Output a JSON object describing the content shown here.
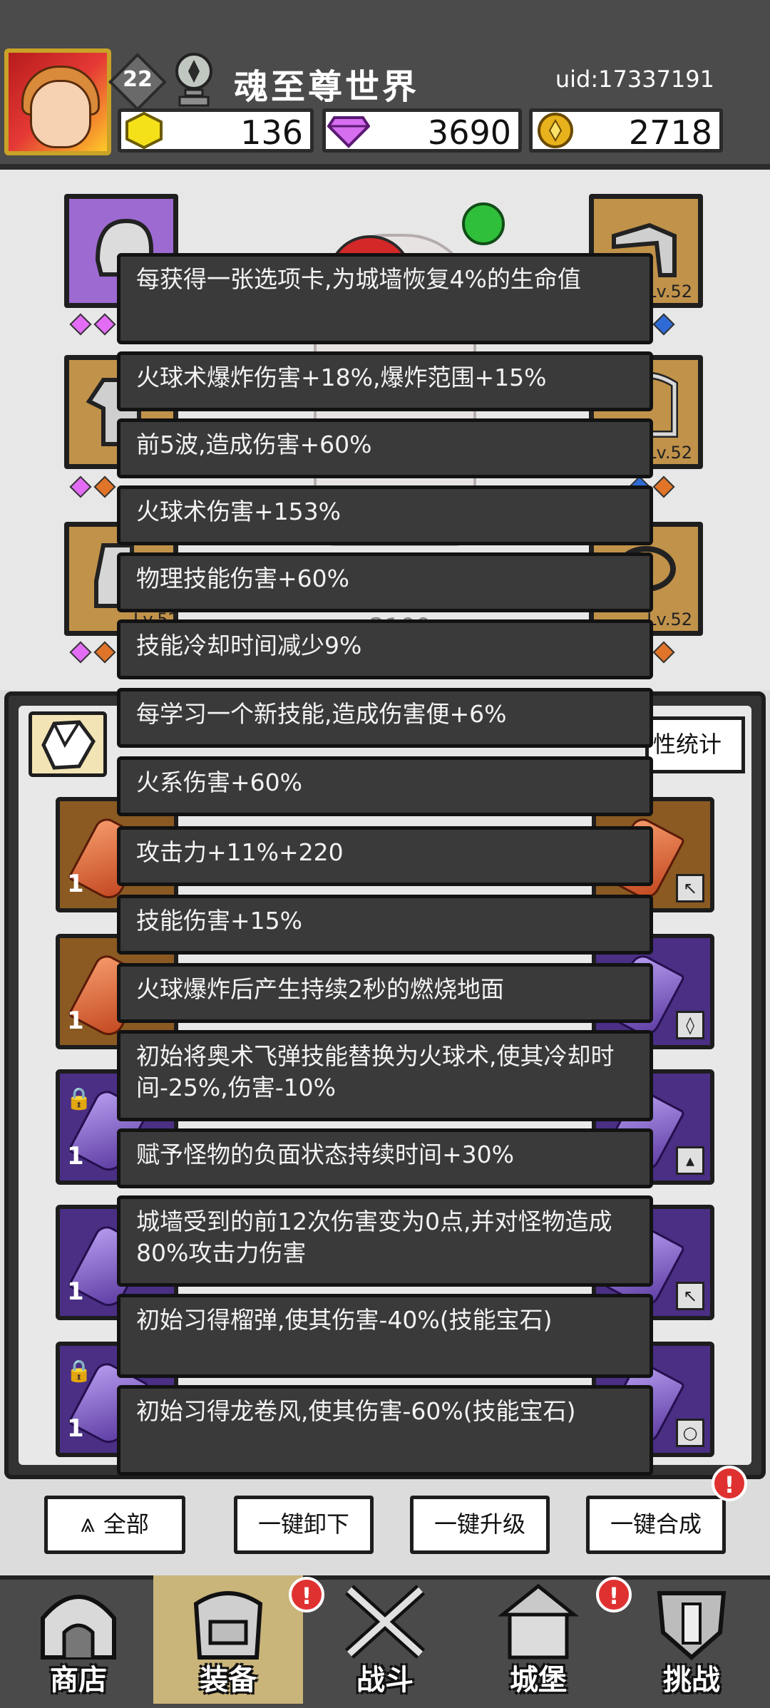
{
  "header": {
    "level": "22",
    "player_name": "魂至尊世界",
    "uid": "uid:17337191",
    "currencies": [
      {
        "icon": "gold-gem-icon",
        "value": "136"
      },
      {
        "icon": "diamond-icon",
        "value": "3690"
      },
      {
        "icon": "coin-icon",
        "value": "2718"
      }
    ]
  },
  "equipment": {
    "slots": [
      {
        "name": "helmet-slot",
        "level": ""
      },
      {
        "name": "weapon-slot",
        "level": "Lv.52"
      },
      {
        "name": "armor-slot",
        "level": ""
      },
      {
        "name": "necklace-slot",
        "level": "Lv.52"
      },
      {
        "name": "boots-slot",
        "level": "Lv.52"
      },
      {
        "name": "ring-slot",
        "level": "Lv.52"
      }
    ],
    "power_partial": "2100"
  },
  "gem_panel": {
    "stats_button": "性统计",
    "counts": [
      "1",
      "1",
      "1",
      "1",
      "1"
    ]
  },
  "tooltip": {
    "lines": [
      "每获得一张选项卡,为城墙恢复4%的生命值",
      "火球术爆炸伤害+18%,爆炸范围+15%",
      "前5波,造成伤害+60%",
      "火球术伤害+153%",
      "物理技能伤害+60%",
      "技能冷却时间减少9%",
      "每学习一个新技能,造成伤害便+6%",
      "火系伤害+60%",
      "攻击力+11%+220",
      "技能伤害+15%",
      "火球爆炸后产生持续2秒的燃烧地面",
      "初始将奥术飞弹技能替换为火球术,使其冷却时间-25%,伤害-10%",
      "赋予怪物的负面状态持续时间+30%",
      "城墙受到的前12次伤害变为0点,并对怪物造成80%攻击力伤害",
      "初始习得榴弹,使其伤害-40%(技能宝石)",
      "初始习得龙卷风,使其伤害-60%(技能宝石)"
    ]
  },
  "actions": {
    "all_label": "全部",
    "unequip_label": "一键卸下",
    "upgrade_label": "一键升级",
    "merge_label": "一键合成"
  },
  "alert_mark": "!",
  "nav": {
    "shop": "商店",
    "equipment": "装备",
    "battle": "战斗",
    "castle": "城堡",
    "challenge": "挑战"
  },
  "colors": {
    "header_bg": "#4b4b4b",
    "tooltip_bg": "#3a3a3a",
    "alert_red": "#e03131",
    "purple_gem": "#e36cf5",
    "orange_gem": "#e07428",
    "blue_gem": "#2e6bd6"
  }
}
